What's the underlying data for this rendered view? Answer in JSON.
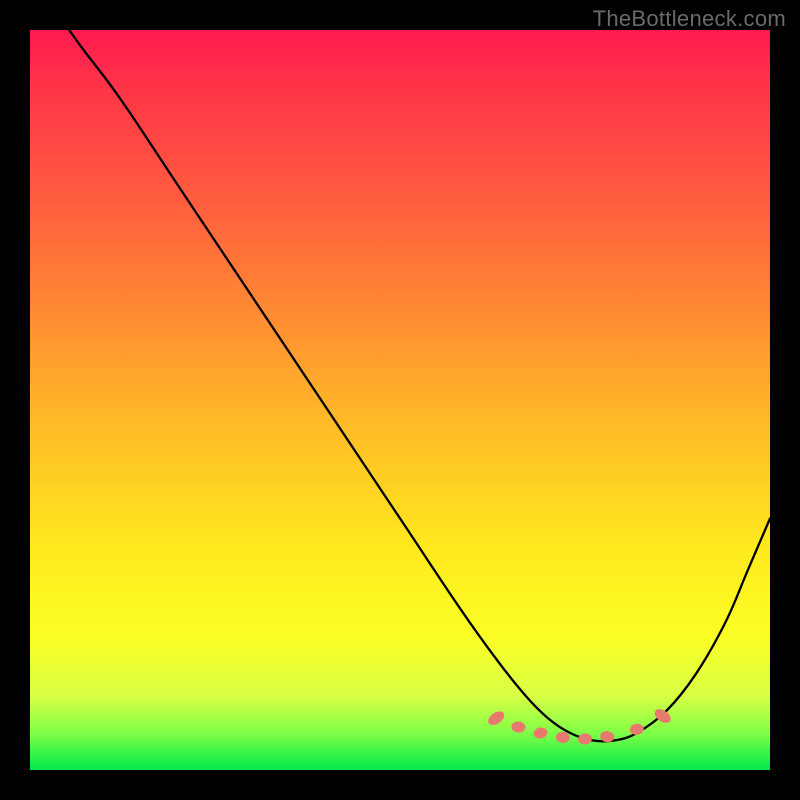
{
  "watermark": "TheBottleneck.com",
  "chart_data": {
    "type": "line",
    "title": "",
    "xlabel": "",
    "ylabel": "",
    "xlim": [
      0,
      1
    ],
    "ylim": [
      0,
      1
    ],
    "x": [
      0.0,
      0.06,
      0.12,
      0.2,
      0.3,
      0.4,
      0.5,
      0.58,
      0.63,
      0.67,
      0.7,
      0.73,
      0.76,
      0.79,
      0.82,
      0.86,
      0.9,
      0.94,
      0.97,
      1.0
    ],
    "values": [
      1.08,
      0.99,
      0.91,
      0.79,
      0.64,
      0.49,
      0.34,
      0.22,
      0.15,
      0.1,
      0.07,
      0.05,
      0.04,
      0.04,
      0.05,
      0.08,
      0.13,
      0.2,
      0.27,
      0.34
    ],
    "marker_points_x": [
      0.63,
      0.66,
      0.69,
      0.72,
      0.75,
      0.78,
      0.82,
      0.855
    ],
    "marker_points_y": [
      0.07,
      0.058,
      0.05,
      0.044,
      0.042,
      0.045,
      0.055,
      0.073
    ],
    "curve_color": "#000000",
    "marker_color": "#e77a6e"
  }
}
